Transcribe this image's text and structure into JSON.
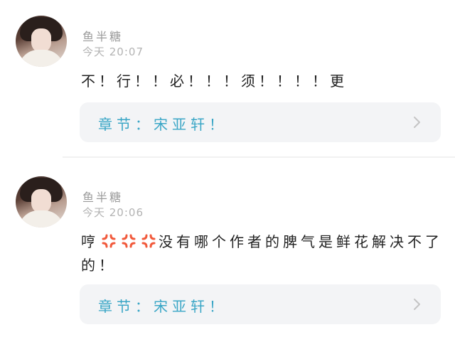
{
  "comments": [
    {
      "username": "鱼半糖",
      "timestamp": "今天 20:07",
      "text": "不！行！！必！！！须！！！！更",
      "chapter_label": "章节：宋亚轩！"
    },
    {
      "username": "鱼半糖",
      "timestamp": "今天 20:06",
      "text_before": "哼",
      "emoji": "anger-symbol-icon",
      "emoji_count": 3,
      "text_after": "没有哪个作者的脾气是鲜花解决不了的！",
      "chapter_label": "章节：宋亚轩！"
    }
  ],
  "colors": {
    "chapter_link": "#3aa6c6",
    "anger_emoji": "#f15a3c",
    "card_bg": "#f3f4f6"
  }
}
